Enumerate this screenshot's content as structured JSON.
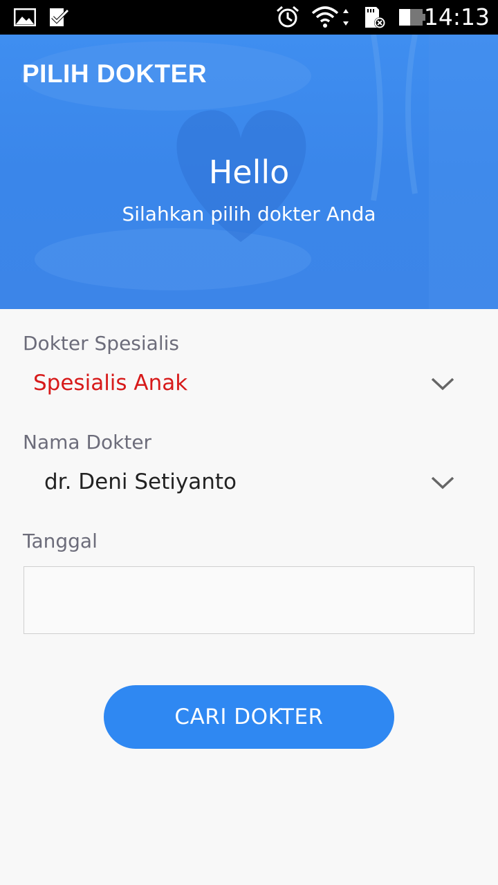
{
  "status_bar": {
    "time": "14:13",
    "icons": [
      "gallery-icon",
      "task-check-icon",
      "alarm-icon",
      "wifi-icon",
      "sd-card-error-icon",
      "battery-icon"
    ]
  },
  "header": {
    "title": "PILIH DOKTER",
    "greeting": "Hello",
    "subtitle": "Silahkan pilih dokter Anda"
  },
  "form": {
    "specialist": {
      "label": "Dokter Spesialis",
      "value": "Spesialis Anak",
      "value_color": "#d71a1a"
    },
    "doctor": {
      "label": "Nama Dokter",
      "value": "dr. Deni Setiyanto"
    },
    "date": {
      "label": "Tanggal",
      "value": ""
    }
  },
  "actions": {
    "search_label": "CARI DOKTER"
  },
  "colors": {
    "primary": "#2f88f2",
    "header_blue": "#3a86ea",
    "accent_red": "#d71a1a"
  }
}
